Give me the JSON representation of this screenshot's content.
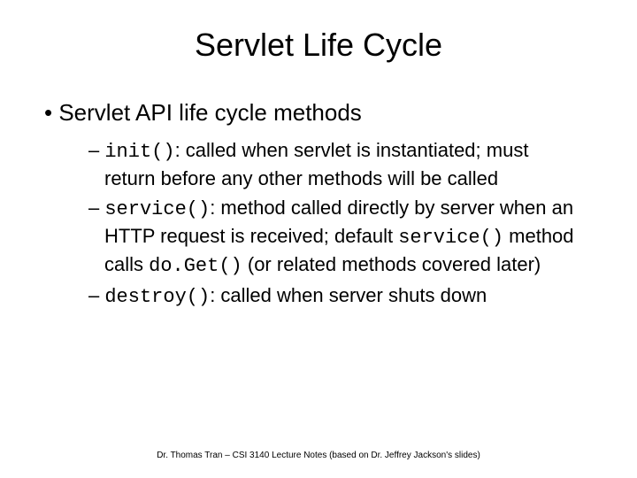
{
  "title": "Servlet Life Cycle",
  "bullet1": "Servlet API life cycle methods",
  "items": [
    {
      "dash": "– ",
      "code1": "init()",
      "text1": ": called when servlet is instantiated; must return before any other methods will be called"
    },
    {
      "dash": "– ",
      "code1": "service()",
      "text1": ": method called directly by server when an HTTP request is received; default ",
      "code2": "service()",
      "text2": " method calls ",
      "code3": "do.Get()",
      "text3": " (or related methods covered later)"
    },
    {
      "dash": "– ",
      "code1": "destroy()",
      "text1": ": called when server shuts down"
    }
  ],
  "footer": "Dr. Thomas Tran – CSI 3140 Lecture Notes (based on Dr. Jeffrey Jackson's slides)"
}
